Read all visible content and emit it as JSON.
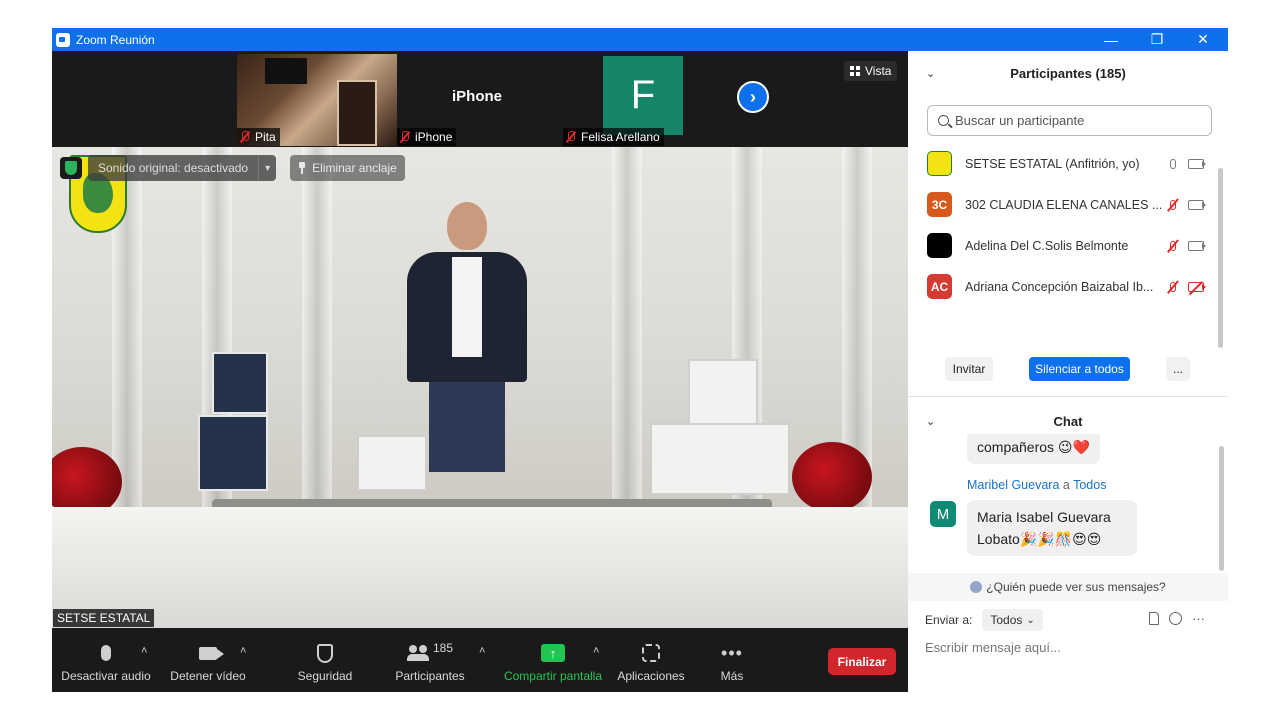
{
  "window": {
    "title": "Zoom Reunión",
    "controls": {
      "minimize": "—",
      "restore": "❐",
      "close": "✕"
    }
  },
  "strip": {
    "thumbnails": [
      {
        "name": "Pita",
        "muted": true
      },
      {
        "name": "iPhone",
        "display_name": "iPhone",
        "muted": true
      },
      {
        "name": "Felisa Arellano",
        "avatar_letter": "F",
        "avatar_color": "#16866b",
        "muted": true
      }
    ],
    "next_icon": "›",
    "view_label": "Vista"
  },
  "main_video": {
    "original_sound_label": "Sonido original: desactivado",
    "caret": "▾",
    "unpin_label": "Eliminar anclaje",
    "speaker_label": "SETSE ESTATAL"
  },
  "toolbar": {
    "mute_label": "Desactivar audio",
    "video_label": "Detener vídeo",
    "security_label": "Seguridad",
    "participants_label": "Participantes",
    "participants_count": "185",
    "share_label": "Compartir pantalla",
    "share_color": "#23c552",
    "apps_label": "Aplicaciones",
    "more_label": "Más",
    "more_glyph": "•••",
    "end_label": "Finalizar",
    "end_color": "#d1262b",
    "caret": "˄",
    "share_arrow": "↑"
  },
  "participants": {
    "header": "Participantes (185)",
    "collapse_icon": "⌄",
    "search_placeholder": "Buscar un participante",
    "list": [
      {
        "initials": "",
        "name": "SETSE ESTATAL (Anfitrión, yo)",
        "avatar_color": "#f3e313",
        "mic_off": false,
        "cam_off": false
      },
      {
        "initials": "3C",
        "name": "302 CLAUDIA ELENA CANALES ...",
        "avatar_color": "#d65a1b",
        "mic_off": true,
        "cam_off": false
      },
      {
        "initials": "",
        "name": "Adelina Del C.Solis Belmonte",
        "avatar_color": "#000000",
        "mic_off": true,
        "cam_off": false
      },
      {
        "initials": "AC",
        "name": "Adriana Concepción Baizabal Ib...",
        "avatar_color": "#d53a33",
        "mic_off": true,
        "cam_off": true
      }
    ],
    "invite_label": "Invitar",
    "mute_all_label": "Silenciar a todos",
    "more_label": "..."
  },
  "chat": {
    "header": "Chat",
    "collapse_icon": "⌄",
    "prev_message_tail": "compañeros 😉❤️",
    "sender": "Maribel Guevara",
    "to_word": "a",
    "recipient": "Todos",
    "sender_initial": "M",
    "message_line1": "Maria Isabel Guevara",
    "message_line2": "Lobato🎉🎉🎊😍😍",
    "who_can_see": "¿Quién puede ver sus mensajes?",
    "send_to_label": "Enviar a:",
    "send_to_value": "Todos",
    "dropdown_caret": "⌄",
    "more_glyph": "···",
    "compose_placeholder": "Escribir mensaje aquí..."
  }
}
